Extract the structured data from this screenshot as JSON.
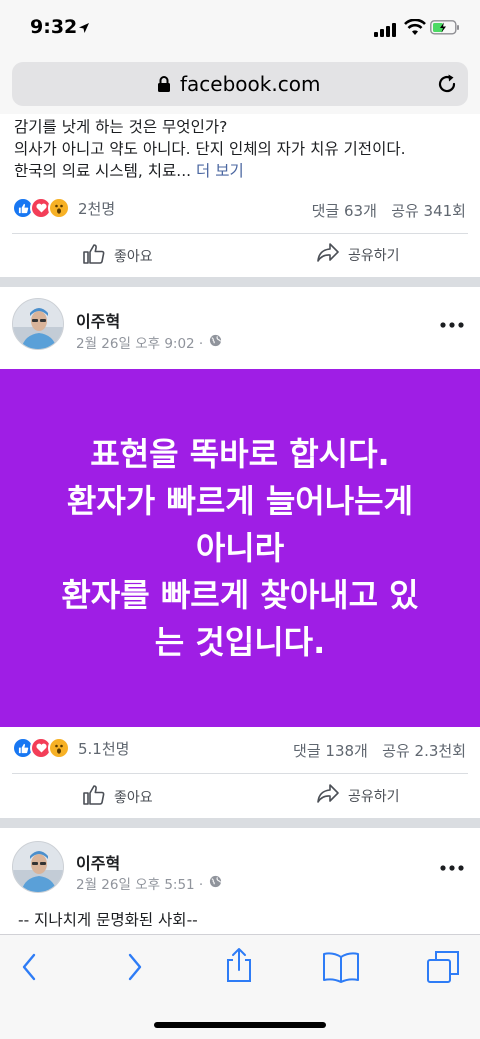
{
  "status_bar": {
    "time": "9:32"
  },
  "browser": {
    "url": "facebook.com"
  },
  "post1": {
    "lines": [
      "감기를 낫게 하는 것은 무엇인가?",
      "의사가 아니고 약도 아니다. 단지 인체의 자가 치유 기전이다.",
      "한국의 의료 시스템, 치료..."
    ],
    "more": "더 보기",
    "reaction_count": "2천명",
    "comments": "댓글 63개",
    "shares": "공유 341회",
    "like_label": "좋아요",
    "share_label": "공유하기"
  },
  "post2": {
    "author": "이주혁",
    "timestamp": "2월 26일 오후 9:02 ·",
    "message_lines": [
      "표현을 똑바로 합시다.",
      "환자가 빠르게 늘어나는게",
      "아니라",
      "환자를 빠르게 찾아내고 있",
      "는 것입니다."
    ],
    "banner_color": "#9f1ee5",
    "reaction_count": "5.1천명",
    "comments": "댓글 138개",
    "shares": "공유 2.3천회",
    "like_label": "좋아요",
    "share_label": "공유하기"
  },
  "post3": {
    "author": "이주혁",
    "timestamp": "2월 26일 오후 5:51 ·",
    "text": "-- 지나치게 문명화된 사회--"
  },
  "icons": [
    "location-arrow-icon",
    "signal-icon",
    "wifi-icon",
    "battery-icon",
    "lock-icon",
    "reload-icon",
    "like-reaction-icon",
    "love-reaction-icon",
    "wow-reaction-icon",
    "thumbs-up-icon",
    "share-arrow-icon",
    "globe-icon",
    "more-icon",
    "back-icon",
    "forward-icon",
    "share-sheet-icon",
    "bookmarks-icon",
    "tabs-icon"
  ],
  "colors": {
    "facebook_blue": "#1877f2",
    "link": "#4b67a1",
    "love": "#f33e58",
    "wow": "#f7b125"
  }
}
